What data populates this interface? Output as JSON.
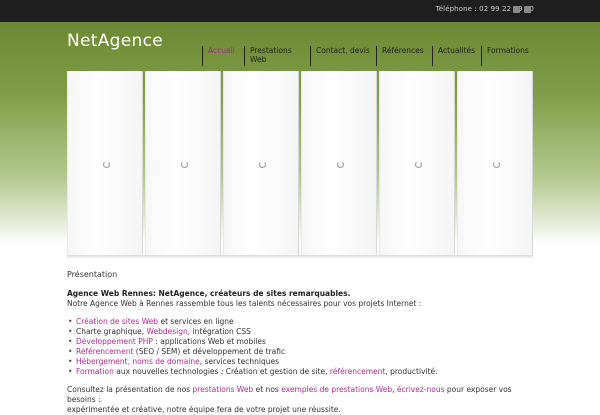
{
  "topbar": {
    "phone": "Téléphone : 02 99 22 29 40",
    "icons": [
      "twitter-icon",
      "rss-icon"
    ]
  },
  "header": {
    "logo": "NetAgence"
  },
  "nav": {
    "items": [
      {
        "label": "Accueil",
        "active": true
      },
      {
        "label": "Prestations Web",
        "active": false
      },
      {
        "label": "Contact, devis",
        "active": false
      },
      {
        "label": "Références",
        "active": false
      },
      {
        "label": "Actualités",
        "active": false
      },
      {
        "label": "Formations",
        "active": false
      }
    ]
  },
  "slider": {
    "panel_count": 6
  },
  "content": {
    "section_title": "Présentation",
    "intro_title": "Agence Web Rennes: NetAgence, créateurs de sites remarquables.",
    "intro_text": "Notre Agence Web à Rennes rassemble tous les talents nécessaires pour vos projets Internet :",
    "services": [
      {
        "parts": [
          {
            "t": "Création de sites Web",
            "link": true
          },
          {
            "t": " et services en ligne",
            "link": false
          }
        ]
      },
      {
        "parts": [
          {
            "t": "Charte graphique, ",
            "link": false
          },
          {
            "t": "Webdesign",
            "link": true
          },
          {
            "t": ", intégration CSS",
            "link": false
          }
        ]
      },
      {
        "parts": [
          {
            "t": "Développement PHP",
            "link": true
          },
          {
            "t": " : applications Web et mobiles",
            "link": false
          }
        ]
      },
      {
        "parts": [
          {
            "t": "Référencement",
            "link": true
          },
          {
            "t": " (SEO / SEM) et développement de trafic",
            "link": false
          }
        ]
      },
      {
        "parts": [
          {
            "t": "Hébergement, noms de domaine",
            "link": true
          },
          {
            "t": ", services techniques",
            "link": false
          }
        ]
      },
      {
        "parts": [
          {
            "t": "Formation",
            "link": true
          },
          {
            "t": " aux nouvelles technologies : Création et gestion de site, ",
            "link": false
          },
          {
            "t": "référencement",
            "link": true
          },
          {
            "t": ", productivité.",
            "link": false
          }
        ]
      }
    ],
    "outro": [
      {
        "t": "Consultez la présentation de nos ",
        "link": false
      },
      {
        "t": "prestations Web",
        "link": true
      },
      {
        "t": " et nos ",
        "link": false
      },
      {
        "t": "exemples de prestations Web",
        "link": true
      },
      {
        "t": ", ",
        "link": false
      },
      {
        "t": "écrivez-nous",
        "link": true
      },
      {
        "t": " pour exposer vos besoins :",
        "link": false
      }
    ],
    "outro_cut": "expérimentée et créative, notre équipe fera de votre projet une réussite."
  },
  "colors": {
    "accent_link": "#b02a94",
    "nav_active": "#9b2a86",
    "header_green": "#6b8930",
    "topbar_bg": "#1e1e1e"
  }
}
